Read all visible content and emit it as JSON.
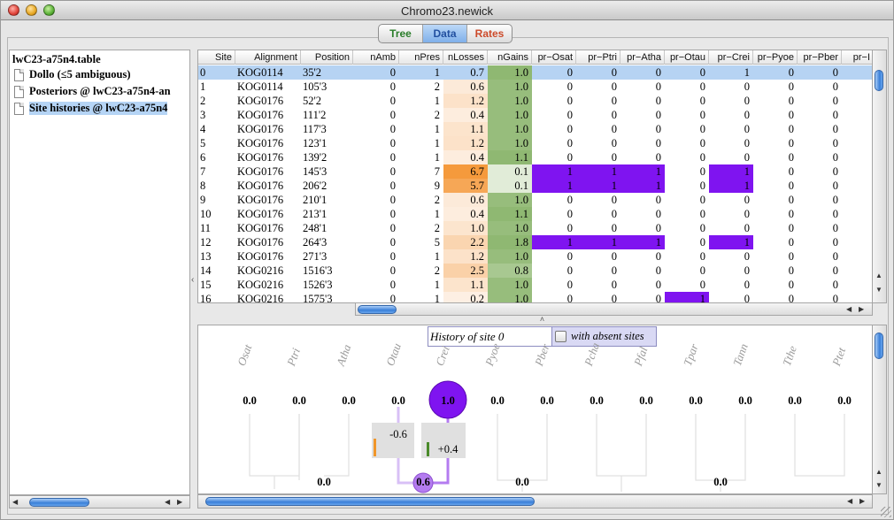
{
  "window": {
    "title": "Chromo23.newick"
  },
  "tabs": [
    {
      "label": "Tree"
    },
    {
      "label": "Data"
    },
    {
      "label": "Rates"
    }
  ],
  "sidebar": {
    "root": "lwC23-a75n4.table",
    "items": [
      {
        "label": "Dollo  (≤5 ambiguous)"
      },
      {
        "label": "Posteriors @ lwC23-a75n4-an"
      },
      {
        "label": "Site histories @ lwC23-a75n4"
      }
    ]
  },
  "table": {
    "columns": [
      "Site",
      "Alignment",
      "Position",
      "nAmb",
      "nPres",
      "nLosses",
      "nGains",
      "pr−Osat",
      "pr−Ptri",
      "pr−Atha",
      "pr−Otau",
      "pr−Crei",
      "pr−Pyoe",
      "pr−Pber",
      "pr−I"
    ],
    "rows": [
      [
        "0",
        "KOG0114",
        "35'2",
        "0",
        "1",
        "0.7",
        "1.0",
        "0",
        "0",
        "0",
        "0",
        "1",
        "0",
        "0"
      ],
      [
        "1",
        "KOG0114",
        "105'3",
        "0",
        "2",
        "0.6",
        "1.0",
        "0",
        "0",
        "0",
        "0",
        "0",
        "0",
        "0"
      ],
      [
        "2",
        "KOG0176",
        "52'2",
        "0",
        "1",
        "1.2",
        "1.0",
        "0",
        "0",
        "0",
        "0",
        "0",
        "0",
        "0"
      ],
      [
        "3",
        "KOG0176",
        "111'2",
        "0",
        "2",
        "0.4",
        "1.0",
        "0",
        "0",
        "0",
        "0",
        "0",
        "0",
        "0"
      ],
      [
        "4",
        "KOG0176",
        "117'3",
        "0",
        "1",
        "1.1",
        "1.0",
        "0",
        "0",
        "0",
        "0",
        "0",
        "0",
        "0"
      ],
      [
        "5",
        "KOG0176",
        "123'1",
        "0",
        "1",
        "1.2",
        "1.0",
        "0",
        "0",
        "0",
        "0",
        "0",
        "0",
        "0"
      ],
      [
        "6",
        "KOG0176",
        "139'2",
        "0",
        "1",
        "0.4",
        "1.1",
        "0",
        "0",
        "0",
        "0",
        "0",
        "0",
        "0"
      ],
      [
        "7",
        "KOG0176",
        "145'3",
        "0",
        "7",
        "6.7",
        "0.1",
        "1",
        "1",
        "1",
        "0",
        "1",
        "0",
        "0"
      ],
      [
        "8",
        "KOG0176",
        "206'2",
        "0",
        "9",
        "5.7",
        "0.1",
        "1",
        "1",
        "1",
        "0",
        "1",
        "0",
        "0"
      ],
      [
        "9",
        "KOG0176",
        "210'1",
        "0",
        "2",
        "0.6",
        "1.0",
        "0",
        "0",
        "0",
        "0",
        "0",
        "0",
        "0"
      ],
      [
        "10",
        "KOG0176",
        "213'1",
        "0",
        "1",
        "0.4",
        "1.1",
        "0",
        "0",
        "0",
        "0",
        "0",
        "0",
        "0"
      ],
      [
        "11",
        "KOG0176",
        "248'1",
        "0",
        "2",
        "1.0",
        "1.0",
        "0",
        "0",
        "0",
        "0",
        "0",
        "0",
        "0"
      ],
      [
        "12",
        "KOG0176",
        "264'3",
        "0",
        "5",
        "2.2",
        "1.8",
        "1",
        "1",
        "1",
        "0",
        "1",
        "0",
        "0"
      ],
      [
        "13",
        "KOG0176",
        "271'3",
        "0",
        "1",
        "1.2",
        "1.0",
        "0",
        "0",
        "0",
        "0",
        "0",
        "0",
        "0"
      ],
      [
        "14",
        "KOG0216",
        "1516'3",
        "0",
        "2",
        "2.5",
        "0.8",
        "0",
        "0",
        "0",
        "0",
        "0",
        "0",
        "0"
      ],
      [
        "15",
        "KOG0216",
        "1526'3",
        "0",
        "1",
        "1.1",
        "1.0",
        "0",
        "0",
        "0",
        "0",
        "0",
        "0",
        "0"
      ],
      [
        "16",
        "KOG0216",
        "1575'3",
        "0",
        "1",
        "0.2",
        "1.0",
        "0",
        "0",
        "0",
        "1",
        "0",
        "0",
        "0"
      ]
    ],
    "colors": {
      "loss_high": "#f59a3c",
      "loss_low": "#fdf2e8",
      "gain_high": "#8fb872",
      "gain_low": "#e9f1e2",
      "presence": "#7f14f0",
      "selected": "#b6d3f3"
    }
  },
  "history": {
    "title": "History of site 0",
    "checkbox_label": "with absent sites",
    "taxa": [
      "Osat",
      "Ptri",
      "Atha",
      "Otau",
      "Crei",
      "Pyoe",
      "Pber",
      "Pcha",
      "Pfal",
      "Tpar",
      "Tann",
      "Tthe",
      "Ptet"
    ],
    "leaf_values": [
      "0.0",
      "0.0",
      "0.0",
      "0.0",
      "1.0",
      "0.0",
      "0.0",
      "0.0",
      "0.0",
      "0.0",
      "0.0",
      "0.0",
      "0.0"
    ],
    "inner_values": [
      "0.0",
      "0.6",
      "0.0",
      "0.0"
    ],
    "loss_label": "-0.6",
    "gain_label": "+0.4",
    "colors": {
      "node_present": "#7f14f0",
      "node_inner": "#b47cf0",
      "loss": "#f0962a",
      "gain": "#4a8a2a"
    }
  }
}
